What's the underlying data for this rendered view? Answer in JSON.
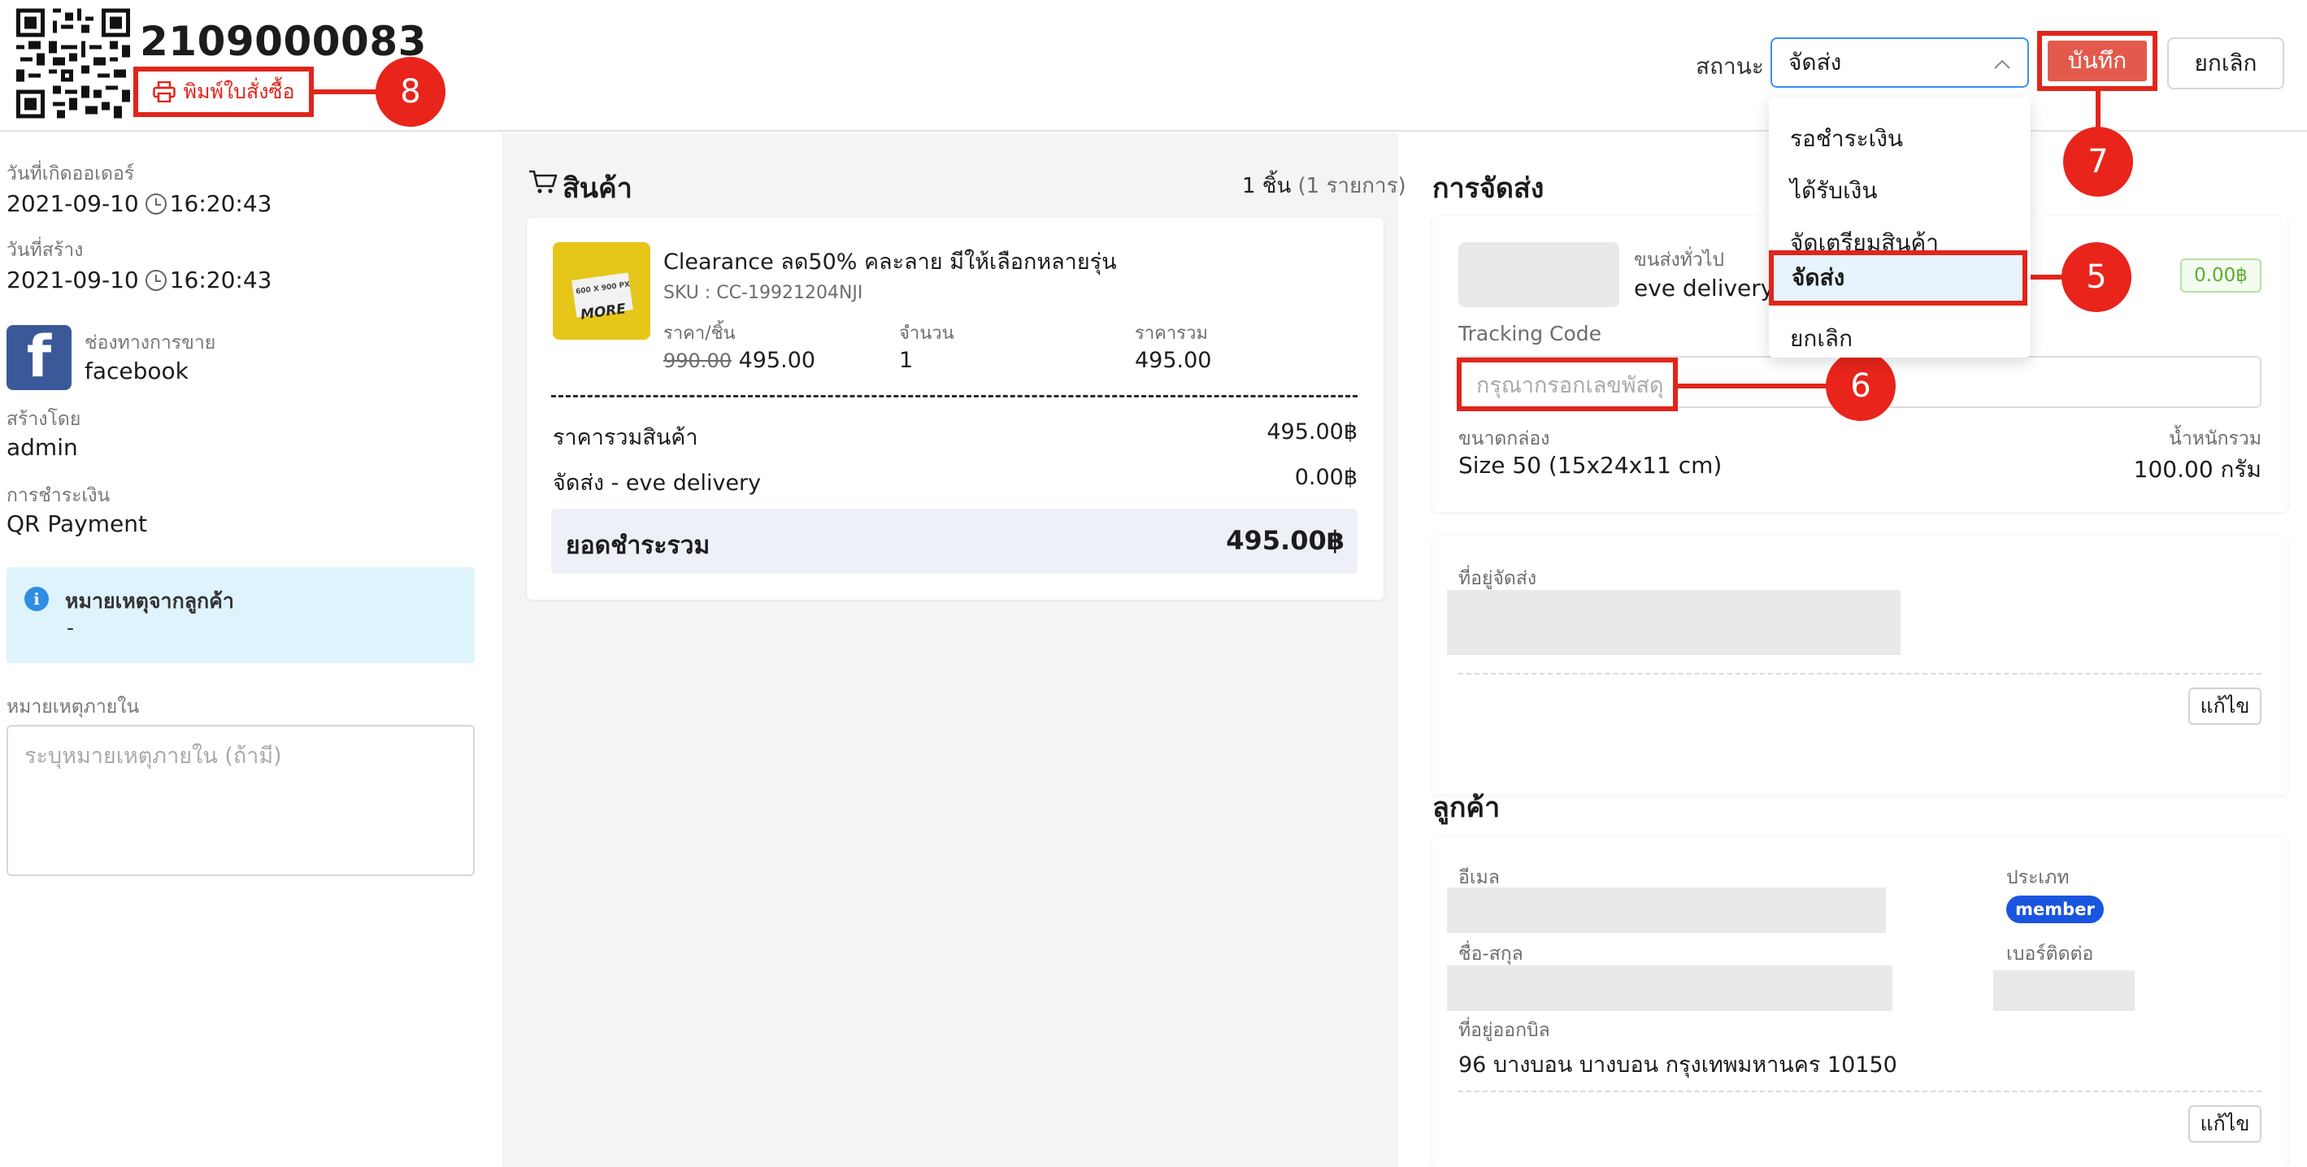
{
  "header": {
    "order_number": "2109000083",
    "print_label": "พิมพ์ใบสั่งซื้อ",
    "status_label": "สถานะ",
    "status_value": "จัดส่ง",
    "save_label": "บันทึก",
    "cancel_label": "ยกเลิก"
  },
  "callouts": [
    "8",
    "7",
    "5",
    "6"
  ],
  "status_options": [
    "รอชำระเงิน",
    "ได้รับเงิน",
    "จัดเตรียมสินค้า",
    "จัดส่ง",
    "ยกเลิก"
  ],
  "left": {
    "order_date_label": "วันที่เกิดออเดอร์",
    "order_date": "2021-09-10",
    "order_time": "16:20:43",
    "created_label": "วันที่สร้าง",
    "created_date": "2021-09-10",
    "created_time": "16:20:43",
    "channel_label": "ช่องทางการขาย",
    "channel_value": "facebook",
    "creator_label": "สร้างโดย",
    "creator_value": "admin",
    "payment_label": "การชำระเงิน",
    "payment_value": "QR Payment",
    "customer_note_title": "หมายเหตุจากลูกค้า",
    "customer_note_value": "-",
    "internal_note_label": "หมายเหตุภายใน",
    "internal_note_placeholder": "ระบุหมายเหตุภายใน (ถ้ามี)"
  },
  "products": {
    "title": "สินค้า",
    "count": "1 ชิ้น",
    "items_count": "(1 รายการ)",
    "item": {
      "name": "Clearance ลด50% คละลาย มีให้เลือกหลายรุ่น",
      "sku": "SKU : CC-19921204NJI",
      "price_label": "ราคา/ชิ้น",
      "original_price": "990.00",
      "price": "495.00",
      "qty_label": "จำนวน",
      "qty": "1",
      "total_label": "ราคารวม",
      "total": "495.00",
      "thumb_label": "600 X 900 PX",
      "thumb_text": "MORE"
    },
    "subtotal_label": "ราคารวมสินค้า",
    "subtotal": "495.00฿",
    "shipping_label": "จัดส่ง - eve delivery",
    "shipping": "0.00฿",
    "grand_total_label": "ยอดชำระรวม",
    "grand_total": "495.00฿"
  },
  "shipping": {
    "title": "การจัดส่ง",
    "carrier_label": "ขนส่งทั่วไป",
    "carrier_value": "eve delivery",
    "cod": "0.00฿",
    "tracking_label": "Tracking Code",
    "tracking_placeholder": "กรุณากรอกเลขพัสดุ",
    "box_label": "ขนาดกล่อง",
    "box_value": "Size 50 (15x24x11 cm)",
    "weight_label": "น้ำหนักรวม",
    "weight_value": "100.00 กรัม"
  },
  "address": {
    "label": "ที่อยู่จัดส่ง",
    "edit_label": "แก้ไข"
  },
  "customer": {
    "title": "ลูกค้า",
    "email_label": "อีเมล",
    "type_label": "ประเภท",
    "type_value": "member",
    "name_label": "ชื่อ-สกุล",
    "phone_label": "เบอร์ติดต่อ",
    "billing_label": "ที่อยู่ออกบิล",
    "billing_value": "96 บางบอน บางบอน กรุงเทพมหานคร 10150",
    "edit_label": "แก้ไข"
  },
  "colors": {
    "callout": "#e1251b",
    "save_button": "#e35a4c",
    "select_border": "#3b8ff2",
    "member_badge": "#1a55e0",
    "cod_green": "#5cad2e",
    "facebook": "#3b5998"
  },
  "icons": [
    "qr-code-icon",
    "printer-icon",
    "chevron-up-icon",
    "clock-icon",
    "facebook-icon",
    "info-icon",
    "cart-icon"
  ]
}
